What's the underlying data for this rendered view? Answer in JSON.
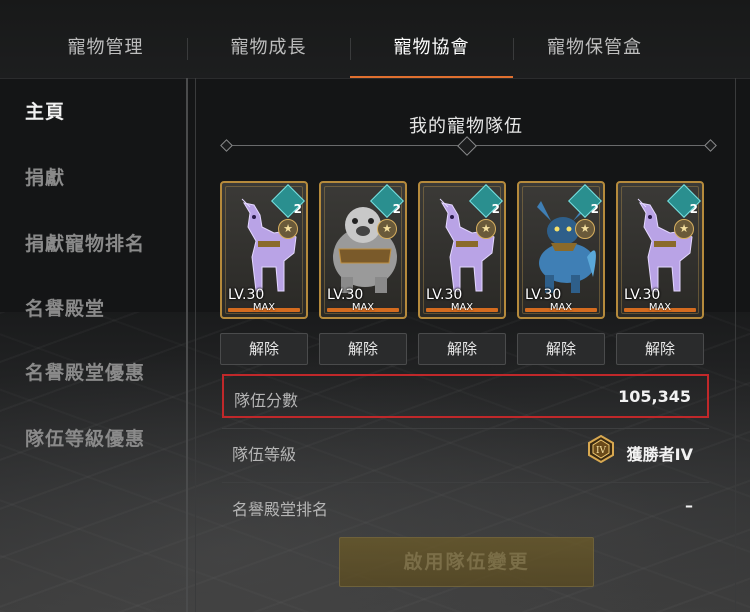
{
  "tabs": [
    {
      "label": "寵物管理",
      "active": false
    },
    {
      "label": "寵物成長",
      "active": false
    },
    {
      "label": "寵物協會",
      "active": true
    },
    {
      "label": "寵物保管盒",
      "active": false
    }
  ],
  "sidebar": {
    "items": [
      {
        "label": "主頁",
        "active": true
      },
      {
        "label": "捐獻",
        "active": false
      },
      {
        "label": "捐獻寵物排名",
        "active": false
      },
      {
        "label": "名譽殿堂",
        "active": false
      },
      {
        "label": "名譽殿堂優惠",
        "active": false
      },
      {
        "label": "隊伍等級優惠",
        "active": false
      }
    ]
  },
  "team": {
    "title": "我的寵物隊伍",
    "pets": [
      {
        "level": "LV.30",
        "max": "MAX",
        "badge": "2",
        "type": "purple-horse",
        "release": "解除"
      },
      {
        "level": "LV.30",
        "max": "MAX",
        "badge": "2",
        "type": "armored-bear",
        "release": "解除"
      },
      {
        "level": "LV.30",
        "max": "MAX",
        "badge": "2",
        "type": "purple-horse",
        "release": "解除"
      },
      {
        "level": "LV.30",
        "max": "MAX",
        "badge": "2",
        "type": "blue-beast",
        "release": "解除"
      },
      {
        "level": "LV.30",
        "max": "MAX",
        "badge": "2",
        "type": "purple-horse",
        "release": "解除"
      }
    ]
  },
  "stats": {
    "score_label": "隊伍分數",
    "score_value": "105,345",
    "level_label": "隊伍等級",
    "level_value": "獲勝者IV",
    "rank_label": "名譽殿堂排名",
    "rank_value": "–"
  },
  "apply_button": "啟用隊伍變更",
  "colors": {
    "accent": "#e0702f",
    "highlight": "#c0282a",
    "card_border": "#b58a3c",
    "purple_pet": "#b9a3e6",
    "blue_pet": "#3f7fb5"
  }
}
